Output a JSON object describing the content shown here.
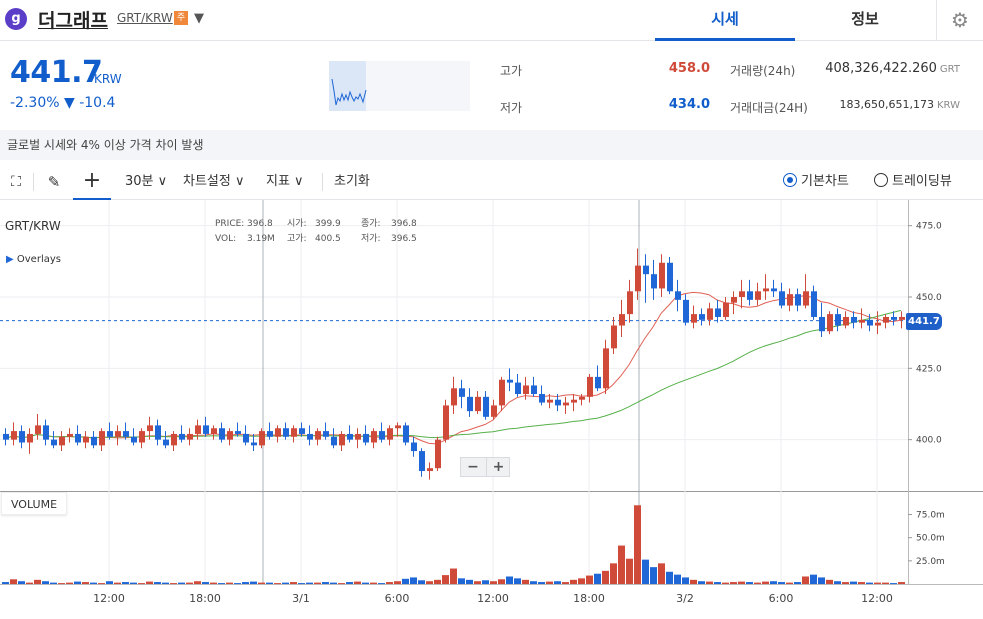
{
  "header": {
    "logo_letter": "g",
    "coin_name": "더그래프",
    "pair": "GRT/KRW",
    "warn_badge": "주",
    "tabs": [
      "시세",
      "정보"
    ]
  },
  "summary": {
    "price": "441.7",
    "unit": "KRW",
    "change_pct": "-2.30%",
    "change_abs": "▼ -10.4",
    "high_label": "고가",
    "high_value": "458.0",
    "low_label": "저가",
    "low_value": "434.0",
    "vol_label": "거래량(24h)",
    "vol_value": "408,326,422.260",
    "vol_unit": "GRT",
    "amt_label": "거래대금(24H)",
    "amt_value": "183,650,651,173",
    "amt_unit": "KRW"
  },
  "notice": "글로벌 시세와 4% 이상 가격 차이 발생",
  "toolbar": {
    "interval": "30분 ∨",
    "settings": "차트설정 ∨",
    "indicator": "지표 ∨",
    "reset": "초기화",
    "basic_chart": "기본차트",
    "trading_view": "트레이딩뷰"
  },
  "chart_info": {
    "pair": "GRT/KRW",
    "overlays": "Overlays",
    "price_lbl": "PRICE:",
    "price": "396.8",
    "open_lbl": "시가:",
    "open": "399.9",
    "close_lbl": "종가:",
    "close": "396.8",
    "vol_lbl": "VOL:",
    "vol": "3.19M",
    "high_lbl": "고가:",
    "high": "400.5",
    "low_lbl": "저가:",
    "low": "396.5",
    "volume_title": "VOLUME",
    "last_price": "441.7"
  },
  "colors": {
    "up": "#d04a3a",
    "down": "#1f67d6",
    "ma_fast": "#e06055",
    "ma_slow": "#56b04a",
    "accent": "#115dcb"
  },
  "chart_data": {
    "type": "candlestick",
    "y_ticks": [
      400,
      425,
      450,
      475
    ],
    "ylim": [
      382,
      484
    ],
    "vol_ticks": [
      "25.0m",
      "50.0m",
      "75.0m"
    ],
    "vol_tick_values": [
      25,
      50,
      75
    ],
    "vol_max": 95,
    "x_tick_labels": [
      "12:00",
      "18:00",
      "3/1",
      "6:00",
      "12:00",
      "18:00",
      "3/2",
      "6:00",
      "12:00"
    ],
    "x_tick_index": [
      13,
      25,
      37,
      49,
      61,
      73,
      85,
      97,
      109
    ],
    "candles": [
      [
        402,
        404,
        398,
        400,
        2.1
      ],
      [
        400,
        406,
        398,
        403,
        5.1
      ],
      [
        403,
        405,
        397,
        399,
        3.0
      ],
      [
        399,
        404,
        395,
        402,
        1.5
      ],
      [
        402,
        409,
        400,
        405,
        4.5
      ],
      [
        405,
        407,
        398,
        400,
        3.0
      ],
      [
        400,
        403,
        397,
        398,
        1.5
      ],
      [
        398,
        403,
        396,
        401,
        1.0
      ],
      [
        401,
        404,
        399,
        402,
        1.5
      ],
      [
        402,
        405,
        398,
        399,
        2.6
      ],
      [
        399,
        403,
        397,
        401,
        2.1
      ],
      [
        401,
        403,
        397,
        398,
        1.5
      ],
      [
        398,
        404,
        396,
        403,
        1.0
      ],
      [
        403,
        406,
        400,
        401,
        3.0
      ],
      [
        401,
        405,
        398,
        403,
        1.5
      ],
      [
        403,
        406,
        400,
        401,
        2.1
      ],
      [
        401,
        404,
        398,
        399,
        1.5
      ],
      [
        399,
        404,
        397,
        403,
        1.0
      ],
      [
        403,
        408,
        400,
        405,
        2.6
      ],
      [
        405,
        407,
        398,
        400,
        2.1
      ],
      [
        400,
        403,
        397,
        398,
        1.5
      ],
      [
        398,
        403,
        396,
        402,
        1.0
      ],
      [
        402,
        405,
        399,
        400,
        1.5
      ],
      [
        400,
        404,
        398,
        402,
        1.5
      ],
      [
        402,
        407,
        400,
        405,
        3.0
      ],
      [
        405,
        408,
        401,
        402,
        2.1
      ],
      [
        402,
        405,
        400,
        404,
        1.5
      ],
      [
        404,
        406,
        399,
        400,
        1.0
      ],
      [
        400,
        404,
        398,
        403,
        1.5
      ],
      [
        403,
        406,
        401,
        402,
        1.0
      ],
      [
        402,
        405,
        398,
        399,
        2.1
      ],
      [
        399,
        402,
        396,
        398,
        2.6
      ],
      [
        398,
        404,
        397,
        403,
        1.5
      ],
      [
        403,
        406,
        400,
        401,
        1.5
      ],
      [
        401,
        405,
        399,
        404,
        1.0
      ],
      [
        404,
        406,
        400,
        401,
        1.5
      ],
      [
        401,
        405,
        399,
        404,
        2.1
      ],
      [
        404,
        406,
        401,
        402,
        1.0
      ],
      [
        402,
        405,
        398,
        400,
        1.5
      ],
      [
        400,
        404,
        398,
        403,
        1.5
      ],
      [
        403,
        406,
        400,
        401,
        2.1
      ],
      [
        401,
        404,
        397,
        398,
        1.5
      ],
      [
        398,
        403,
        396,
        402,
        1.0
      ],
      [
        402,
        405,
        399,
        400,
        2.1
      ],
      [
        400,
        404,
        397,
        402,
        2.6
      ],
      [
        402,
        405,
        398,
        399,
        1.5
      ],
      [
        399,
        404,
        397,
        403,
        1.5
      ],
      [
        403,
        406,
        399,
        400,
        1.0
      ],
      [
        400,
        405,
        398,
        404,
        2.1
      ],
      [
        404,
        406,
        401,
        405,
        3.0
      ],
      [
        405,
        406,
        398,
        399,
        5.6
      ],
      [
        399,
        401,
        394,
        396,
        7.1
      ],
      [
        396,
        397,
        387,
        389,
        4.0
      ],
      [
        389,
        392,
        386,
        390,
        3.0
      ],
      [
        390,
        401,
        389,
        400,
        4.5
      ],
      [
        400,
        414,
        399,
        412,
        9.6
      ],
      [
        412,
        422,
        409,
        418,
        16.7
      ],
      [
        418,
        421,
        411,
        415,
        6.1
      ],
      [
        415,
        418,
        408,
        410,
        4.5
      ],
      [
        410,
        417,
        409,
        415,
        3.0
      ],
      [
        415,
        417,
        407,
        408,
        4.0
      ],
      [
        408,
        414,
        407,
        412,
        3.0
      ],
      [
        412,
        422,
        410,
        421,
        5.1
      ],
      [
        421,
        425,
        417,
        420,
        8.1
      ],
      [
        420,
        423,
        415,
        416,
        6.1
      ],
      [
        416,
        422,
        414,
        419,
        4.5
      ],
      [
        419,
        422,
        415,
        416,
        3.0
      ],
      [
        416,
        419,
        412,
        413,
        2.1
      ],
      [
        413,
        416,
        411,
        414,
        2.6
      ],
      [
        414,
        416,
        410,
        412,
        3.0
      ],
      [
        412,
        415,
        409,
        413,
        2.1
      ],
      [
        413,
        416,
        410,
        414,
        4.5
      ],
      [
        414,
        416,
        412,
        415,
        6.1
      ],
      [
        415,
        423,
        413,
        422,
        9.1
      ],
      [
        422,
        426,
        417,
        418,
        11.1
      ],
      [
        418,
        435,
        416,
        432,
        14.2
      ],
      [
        432,
        443,
        430,
        440,
        22.3
      ],
      [
        440,
        449,
        436,
        444,
        41.5
      ],
      [
        444,
        456,
        441,
        452,
        27.3
      ],
      [
        452,
        467,
        449,
        461,
        85.0
      ],
      [
        461,
        465,
        448,
        458,
        26.3
      ],
      [
        458,
        463,
        449,
        453,
        18.2
      ],
      [
        453,
        465,
        450,
        462,
        22.3
      ],
      [
        462,
        464,
        451,
        452,
        13.2
      ],
      [
        452,
        456,
        445,
        449,
        10.1
      ],
      [
        449,
        451,
        440,
        441,
        7.1
      ],
      [
        441,
        447,
        439,
        444,
        4.5
      ],
      [
        444,
        446,
        440,
        442,
        3.0
      ],
      [
        442,
        448,
        440,
        446,
        2.6
      ],
      [
        446,
        449,
        441,
        443,
        2.1
      ],
      [
        443,
        450,
        442,
        448,
        1.5
      ],
      [
        448,
        452,
        444,
        450,
        2.1
      ],
      [
        450,
        456,
        446,
        452,
        2.6
      ],
      [
        452,
        456,
        447,
        449,
        2.1
      ],
      [
        449,
        455,
        447,
        452,
        1.5
      ],
      [
        452,
        458,
        449,
        453,
        2.6
      ],
      [
        453,
        456,
        450,
        452,
        3.0
      ],
      [
        452,
        455,
        446,
        447,
        2.1
      ],
      [
        447,
        453,
        445,
        451,
        1.5
      ],
      [
        451,
        453,
        445,
        447,
        2.1
      ],
      [
        447,
        458,
        446,
        452,
        8.1
      ],
      [
        452,
        454,
        442,
        443,
        10.1
      ],
      [
        443,
        448,
        436,
        438,
        7.1
      ],
      [
        438,
        445,
        437,
        444,
        4.5
      ],
      [
        444,
        446,
        438,
        440,
        3.0
      ],
      [
        440,
        445,
        439,
        443,
        2.1
      ],
      [
        443,
        445,
        439,
        441,
        2.6
      ],
      [
        441,
        446,
        439,
        442,
        2.1
      ],
      [
        442,
        444,
        438,
        440,
        1.5
      ],
      [
        440,
        445,
        437,
        441,
        1.5
      ],
      [
        441,
        444,
        439,
        443,
        1.5
      ],
      [
        443,
        445,
        440,
        442,
        1.0
      ],
      [
        442,
        445,
        439,
        443,
        2.1
      ]
    ]
  }
}
